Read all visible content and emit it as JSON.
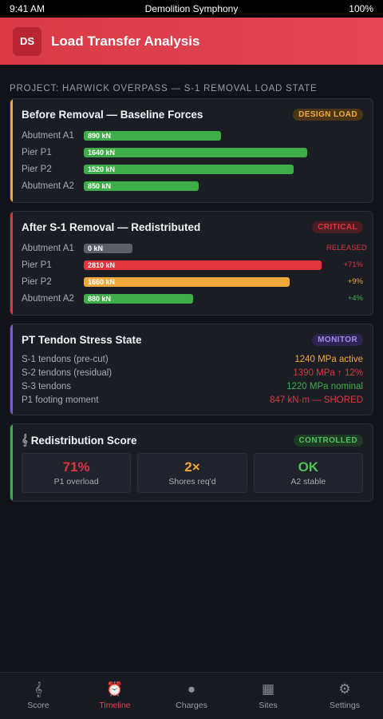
{
  "status": {
    "time": "9:41 AM",
    "app": "Demolition Symphony",
    "battery": "100%"
  },
  "header": {
    "logo": "DS",
    "title": "Load Transfer Analysis"
  },
  "project_line": "PROJECT: HARWICK OVERPASS — S-1 REMOVAL LOAD STATE",
  "colors": {
    "green": "#3fae49",
    "red": "#e0353f",
    "orange": "#f2a93b",
    "gray": "#5b5e66",
    "purple": "#7a5ad8"
  },
  "before": {
    "title": "Before Removal — Baseline Forces",
    "badge": "DESIGN LOAD",
    "rows": [
      {
        "label": "Abutment A1",
        "value": "890 kN",
        "kn": 890
      },
      {
        "label": "Pier P1",
        "value": "1640 kN",
        "kn": 1640
      },
      {
        "label": "Pier P2",
        "value": "1520 kN",
        "kn": 1520
      },
      {
        "label": "Abutment A2",
        "value": "850 kN",
        "kn": 850
      }
    ]
  },
  "after": {
    "title": "After S-1 Removal — Redistributed",
    "badge": "CRITICAL",
    "rows": [
      {
        "label": "Abutment A1",
        "value": "0 kN",
        "kn": 0,
        "note": "RELEASED"
      },
      {
        "label": "Pier P1",
        "value": "2810 kN",
        "kn": 2810,
        "note": "+71%"
      },
      {
        "label": "Pier P2",
        "value": "1660 kN",
        "kn": 1660,
        "note": "+9%"
      },
      {
        "label": "Abutment A2",
        "value": "880 kN",
        "kn": 880,
        "note": "+4%"
      }
    ]
  },
  "tendon": {
    "title": "PT Tendon Stress State",
    "badge": "MONITOR",
    "rows": [
      {
        "label": "S-1 tendons (pre-cut)",
        "value": "1240 MPa active"
      },
      {
        "label": "S-2 tendons (residual)",
        "value": "1390 MPa ↑ 12%"
      },
      {
        "label": "S-3 tendons",
        "value": "1220 MPa nominal"
      },
      {
        "label": "P1 footing moment",
        "value": "847 kN·m — SHORED"
      }
    ]
  },
  "score": {
    "icon": "music-score-icon",
    "title": "Redistribution Score",
    "badge": "CONTROLLED",
    "metrics": [
      {
        "value": "71%",
        "label": "P1 overload"
      },
      {
        "value": "2×",
        "label": "Shores req'd"
      },
      {
        "value": "OK",
        "label": "A2 stable"
      }
    ]
  },
  "tabs": [
    {
      "label": "Score",
      "icon": "music-score-icon"
    },
    {
      "label": "Timeline",
      "icon": "alarm-clock-icon"
    },
    {
      "label": "Charges",
      "icon": "bomb-icon"
    },
    {
      "label": "Sites",
      "icon": "building-icon"
    },
    {
      "label": "Settings",
      "icon": "gear-icon"
    }
  ],
  "active_tab": "Timeline"
}
